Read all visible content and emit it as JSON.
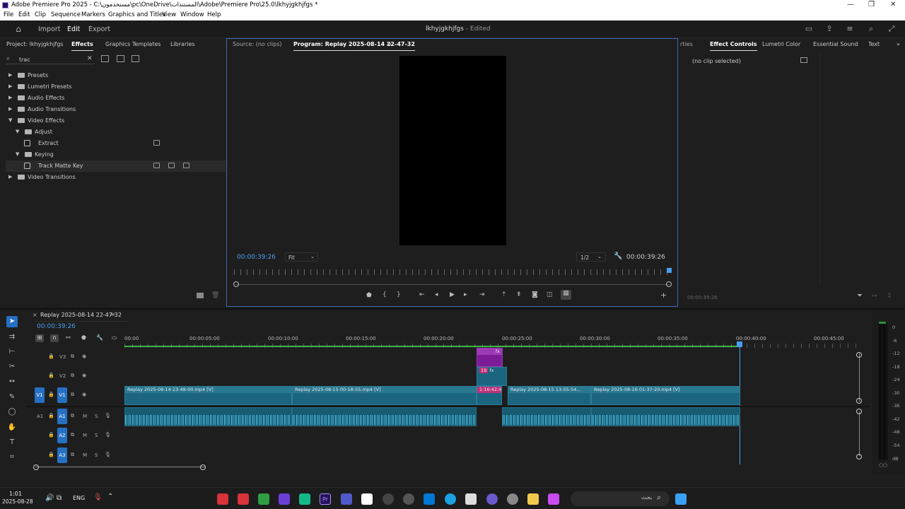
{
  "window": {
    "title": "Adobe Premiere Pro 2025 - C:\\مستخدمون\\pc\\OneDrive\\المستندات\\Adobe\\Premiere Pro\\25.0\\lkhyjgkhjfgs *",
    "minimize": "—",
    "maximize": "❐",
    "close": "✕"
  },
  "menu": [
    "File",
    "Edit",
    "Clip",
    "Sequence",
    "Markers",
    "Graphics and Titles",
    "View",
    "Window",
    "Help"
  ],
  "header": {
    "tabs": [
      "Import",
      "Edit",
      "Export"
    ],
    "active_tab": "Edit",
    "project_name": "lkhyjgkhjfgs",
    "status": "- Edited"
  },
  "effects_panel": {
    "tabs": [
      "Project: lkhyjgkhjfgs",
      "Effects",
      "Graphics Templates",
      "Libraries"
    ],
    "search_value": "trac",
    "tree": [
      {
        "label": "Presets",
        "kind": "folder",
        "level": 0,
        "arrow": "▶"
      },
      {
        "label": "Lumetri Presets",
        "kind": "folder",
        "level": 0,
        "arrow": "▶"
      },
      {
        "label": "Audio Effects",
        "kind": "folder",
        "level": 0,
        "arrow": "▶"
      },
      {
        "label": "Audio Transitions",
        "kind": "folder",
        "level": 0,
        "arrow": "▶"
      },
      {
        "label": "Video Effects",
        "kind": "folder",
        "level": 0,
        "arrow": "▼"
      },
      {
        "label": "Adjust",
        "kind": "folder",
        "level": 1,
        "arrow": "▼"
      },
      {
        "label": "Extract",
        "kind": "effect",
        "level": 2,
        "arrow": ""
      },
      {
        "label": "Keying",
        "kind": "folder",
        "level": 1,
        "arrow": "▼"
      },
      {
        "label": "Track Matte Key",
        "kind": "effect",
        "level": 2,
        "arrow": ""
      },
      {
        "label": "Video Transitions",
        "kind": "folder",
        "level": 0,
        "arrow": "▶"
      }
    ]
  },
  "program_monitor": {
    "tabs": [
      "Source: (no clips)",
      "Program: Replay 2025-08-14 22-47-32"
    ],
    "timecode_in": "00:00:39:26",
    "timecode_out": "00:00:39:26",
    "fit": "Fit",
    "resolution": "1/2"
  },
  "effect_controls": {
    "tabs": [
      "rties",
      "Effect Controls",
      "Lumetri Color",
      "Essential Sound",
      "Text"
    ],
    "empty_message": "(no clip selected)",
    "footer_timecode": "00:00:39:26"
  },
  "timeline": {
    "sequence_name": "Replay 2025-08-14 22-47-32",
    "timecode": "00:00:39:26",
    "ruler": [
      "00:00",
      "00:00:05:00",
      "00:00:10:00",
      "00:00:15:00",
      "00:00:20:00",
      "00:00:25:00",
      "00:00:30:00",
      "00:00:35:00",
      "00:00:40:00",
      "00:00:45:00"
    ],
    "video_tracks": [
      "V3",
      "V2",
      "V1"
    ],
    "audio_tracks": [
      "A1",
      "A2",
      "A3"
    ],
    "clips": [
      "Replay 2025-08-14 23-48-00.mp4 [V]",
      "Replay 2025-08-15 00-18-55.mp4 [V]",
      "Replay 2025-08-15 13-55-54...",
      "Replay 2025-08-16 01-37-20.mp4 [V]"
    ],
    "small_clip_labels": [
      "1:16:42:4",
      "19",
      "fx"
    ],
    "track_buttons": [
      "M",
      "S"
    ]
  },
  "meters": {
    "scale": [
      "0",
      "-6",
      "-12",
      "-18",
      "-24",
      "-30",
      "-36",
      "-42",
      "-48",
      "-54",
      "dB"
    ]
  },
  "taskbar": {
    "time": "1:01",
    "date": "2025-08-28",
    "language": "ENG",
    "search": "بحث"
  }
}
